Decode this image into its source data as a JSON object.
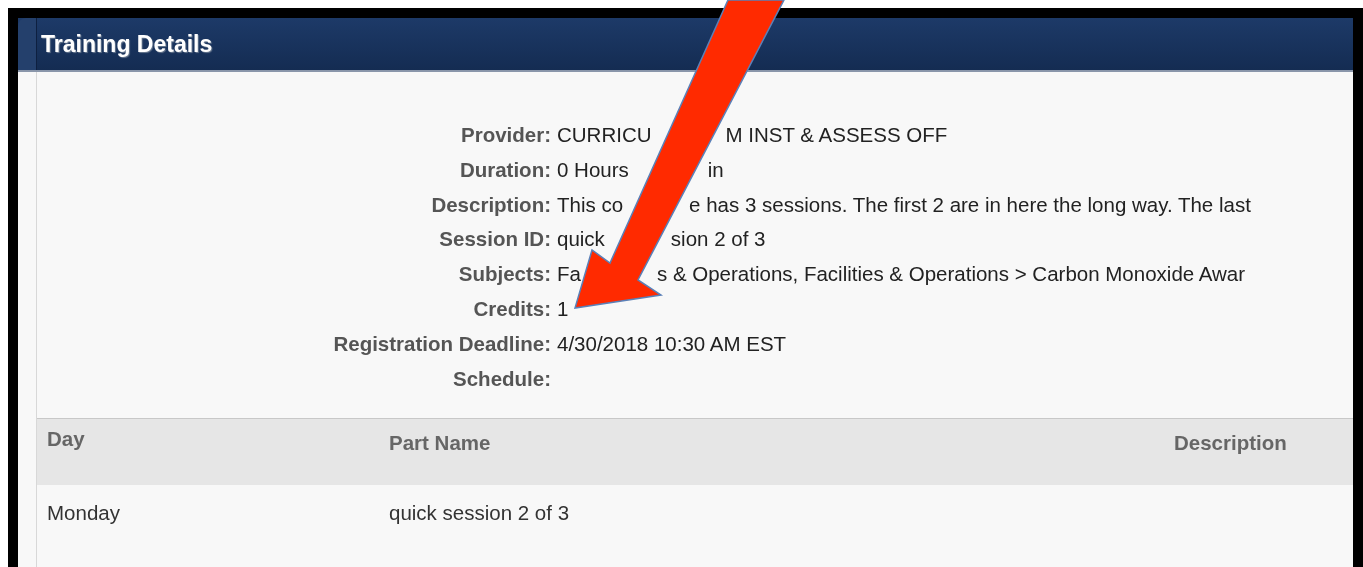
{
  "panel": {
    "title": "Training Details"
  },
  "details": [
    {
      "label": "Provider:",
      "parts": [
        "CURRICU",
        "M INST & ASSESS OFF"
      ]
    },
    {
      "label": "Duration:",
      "parts": [
        "0 Hours",
        "in"
      ]
    },
    {
      "label": "Description:",
      "parts": [
        "This co",
        "e has 3 sessions. The first 2 are in here the long way. The last"
      ]
    },
    {
      "label": "Session ID:",
      "parts": [
        "quick",
        "sion 2 of 3"
      ]
    },
    {
      "label": "Subjects:",
      "parts": [
        "Fa",
        "s & Operations, Facilities & Operations > Carbon Monoxide Awar"
      ]
    },
    {
      "label": "Credits:",
      "parts": [
        "1"
      ]
    },
    {
      "label": "Registration Deadline:",
      "parts": [
        "4/30/2018 10:30 AM EST"
      ]
    },
    {
      "label": "Schedule:"
    }
  ],
  "table": {
    "columns": [
      "Day",
      "Part Name",
      "Description"
    ],
    "rows": [
      [
        "Monday",
        "quick session 2 of 3"
      ]
    ]
  }
}
